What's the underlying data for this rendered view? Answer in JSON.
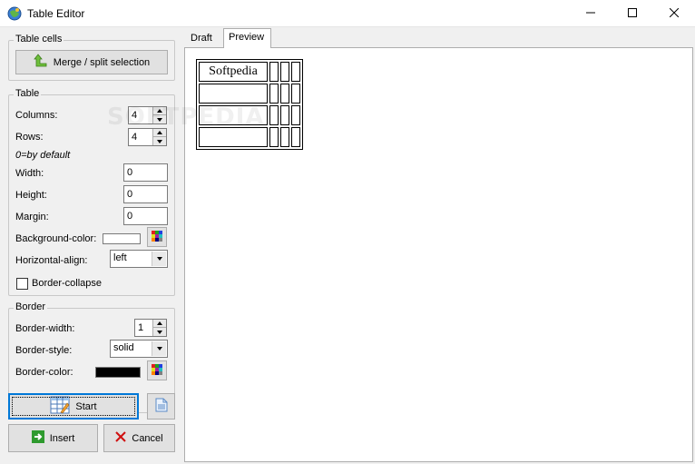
{
  "window": {
    "title": "Table Editor",
    "icons": {
      "app": "globe-icon",
      "minimize": "minimize-icon",
      "maximize": "maximize-icon",
      "close": "close-icon"
    }
  },
  "cells_group": {
    "title": "Table cells",
    "merge_label": "Merge / split selection"
  },
  "table_group": {
    "title": "Table",
    "columns_label": "Columns:",
    "columns_value": "4",
    "rows_label": "Rows:",
    "rows_value": "4",
    "default_hint": "0=by default",
    "width_label": "Width:",
    "width_value": "0",
    "height_label": "Height:",
    "height_value": "0",
    "margin_label": "Margin:",
    "margin_value": "0",
    "bgcolor_label": "Background-color:",
    "bgcolor_value": "#ffffff",
    "halign_label": "Horizontal-align:",
    "halign_value": "left",
    "collapse_label": "Border-collapse",
    "collapse_checked": false
  },
  "border_group": {
    "title": "Border",
    "width_label": "Border-width:",
    "width_value": "1",
    "style_label": "Border-style:",
    "style_value": "solid",
    "color_label": "Border-color:",
    "color_value": "#000000"
  },
  "actions": {
    "start_label": "Start",
    "insert_label": "Insert",
    "cancel_label": "Cancel"
  },
  "tabs": [
    {
      "label": "Draft",
      "active": false
    },
    {
      "label": "Preview",
      "active": true
    }
  ],
  "preview_table": {
    "rows": [
      [
        "Softpedia",
        "",
        "",
        ""
      ],
      [
        "",
        "",
        "",
        ""
      ],
      [
        "",
        "",
        "",
        ""
      ],
      [
        "",
        "",
        "",
        ""
      ]
    ]
  },
  "watermark": "SOFTPEDIA"
}
